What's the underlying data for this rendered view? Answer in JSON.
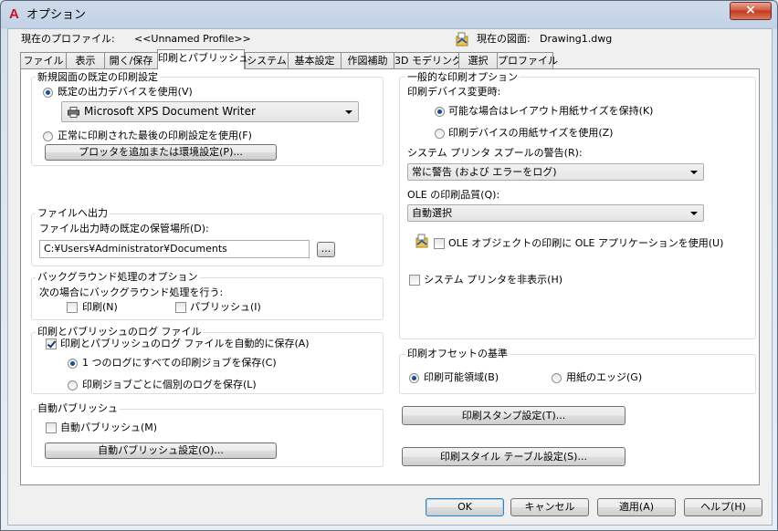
{
  "window": {
    "title": "オプション",
    "close_icon": "×"
  },
  "header": {
    "profile_label": "現在のプロファイル:",
    "profile_value": "<<Unnamed Profile>>",
    "drawing_label": "現在の図面:",
    "drawing_value": "Drawing1.dwg"
  },
  "tabs": [
    {
      "label": "ファイル"
    },
    {
      "label": "表示"
    },
    {
      "label": "開く/保存"
    },
    {
      "label": "印刷とパブリッシュ",
      "active": true
    },
    {
      "label": "システム"
    },
    {
      "label": "基本設定"
    },
    {
      "label": "作図補助"
    },
    {
      "label": "3D モデリング"
    },
    {
      "label": "選択"
    },
    {
      "label": "プロファイル"
    }
  ],
  "new_drawing": {
    "title": "新規図面の既定の印刷設定",
    "use_default_device": "既定の出力デバイスを使用(V)",
    "device_value": "Microsoft XPS Document Writer",
    "use_last_settings": "正常に印刷された最後の印刷設定を使用(F)",
    "add_plotter_button": "プロッタを追加または環境設定(P)..."
  },
  "file_output": {
    "title": "ファイルへ出力",
    "location_label": "ファイル出力時の既定の保管場所(D):",
    "location_value": "C:¥Users¥Administrator¥Documents",
    "browse_button": "..."
  },
  "background": {
    "title": "バックグラウンド処理のオプション",
    "when_label": "次の場合にバックグラウンド処理を行う:",
    "plot_label": "印刷(N)",
    "publish_label": "パブリッシュ(I)"
  },
  "log": {
    "title": "印刷とパブリッシュのログ ファイル",
    "auto_save": "印刷とパブリッシュのログ ファイルを自動的に保存(A)",
    "single_log": "1 つのログにすべての印刷ジョブを保存(C)",
    "per_job_log": "印刷ジョブごとに個別のログを保存(L)"
  },
  "auto_publish": {
    "title": "自動パブリッシュ",
    "checkbox": "自動パブリッシュ(M)",
    "settings_button": "自動パブリッシュ設定(O)..."
  },
  "general": {
    "title": "一般的な印刷オプション",
    "device_change_label": "印刷デバイス変更時:",
    "keep_layout_size": "可能な場合はレイアウト用紙サイズを保持(K)",
    "use_device_size": "印刷デバイスの用紙サイズを使用(Z)",
    "spool_alert_label": "システム プリンタ スプールの警告(R):",
    "spool_alert_value": "常に警告 (および エラーをログ)",
    "ole_quality_label": "OLE の印刷品質(Q):",
    "ole_quality_value": "自動選択",
    "ole_app_checkbox": "OLE オブジェクトの印刷に OLE アプリケーションを使用(U)",
    "hide_printers": "システム プリンタを非表示(H)"
  },
  "offset": {
    "title": "印刷オフセットの基準",
    "printable_area": "印刷可能領域(B)",
    "paper_edge": "用紙のエッジ(G)"
  },
  "side_buttons": {
    "stamp": "印刷スタンプ設定(T)...",
    "style_table": "印刷スタイル テーブル設定(S)..."
  },
  "footer": {
    "ok": "OK",
    "cancel": "キャンセル",
    "apply": "適用(A)",
    "help": "ヘルプ(H)"
  }
}
